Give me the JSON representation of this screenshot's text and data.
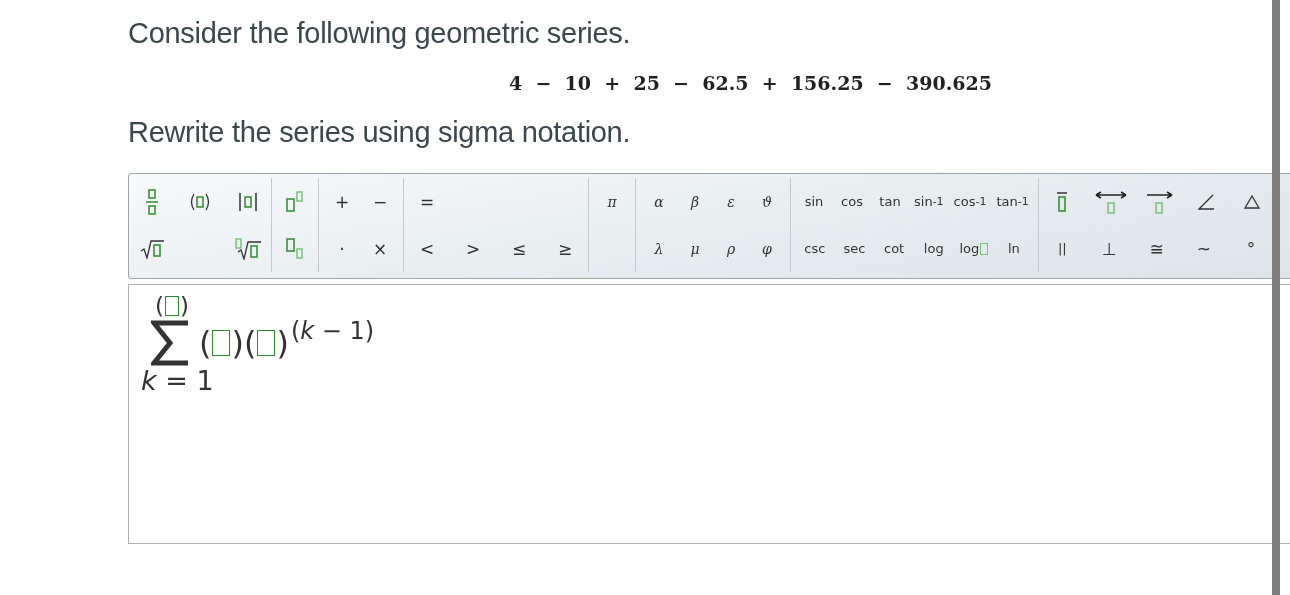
{
  "question": {
    "intro": "Consider the following geometric series.",
    "series": "4  −  10  +  25  −  62.5  +  156.25  −  390.625",
    "prompt": "Rewrite the series using sigma notation."
  },
  "toolbar": {
    "groups": [
      {
        "top": [
          {
            "kind": "fraction"
          },
          {
            "kind": "parens"
          },
          {
            "kind": "abs"
          }
        ],
        "bottom": [
          {
            "kind": "sqrt"
          },
          {
            "kind": "nthroot"
          }
        ]
      },
      {
        "top": [
          {
            "kind": "superscript"
          }
        ],
        "bottom": [
          {
            "kind": "subscript"
          }
        ]
      },
      {
        "top": [
          {
            "kind": "text",
            "label": "+"
          },
          {
            "kind": "text",
            "label": "−"
          }
        ],
        "bottom": [
          {
            "kind": "text",
            "label": "·"
          },
          {
            "kind": "text",
            "label": "×"
          }
        ]
      },
      {
        "top": [
          {
            "kind": "text",
            "label": "="
          }
        ],
        "bottom": [
          {
            "kind": "text",
            "label": "<"
          },
          {
            "kind": "text",
            "label": ">"
          },
          {
            "kind": "text",
            "label": "≤"
          },
          {
            "kind": "text",
            "label": "≥"
          }
        ]
      },
      {
        "top": [
          {
            "kind": "greek",
            "label": "π"
          }
        ]
      },
      {
        "top": [
          {
            "kind": "greek",
            "label": "α"
          },
          {
            "kind": "greek",
            "label": "β"
          },
          {
            "kind": "greek",
            "label": "ε"
          },
          {
            "kind": "greek",
            "label": "ϑ"
          }
        ],
        "bottom": [
          {
            "kind": "greek",
            "label": "λ"
          },
          {
            "kind": "greek",
            "label": "μ"
          },
          {
            "kind": "greek",
            "label": "ρ"
          },
          {
            "kind": "greek",
            "label": "φ"
          }
        ]
      },
      {
        "top": [
          {
            "kind": "text",
            "label": "sin"
          },
          {
            "kind": "text",
            "label": "cos"
          },
          {
            "kind": "text",
            "label": "tan"
          },
          {
            "kind": "inverse",
            "label": "sin",
            "sup": "-1"
          },
          {
            "kind": "inverse",
            "label": "cos",
            "sup": "-1"
          },
          {
            "kind": "inverse",
            "label": "tan",
            "sup": "-1"
          }
        ],
        "bottom": [
          {
            "kind": "text",
            "label": "csc"
          },
          {
            "kind": "text",
            "label": "sec"
          },
          {
            "kind": "text",
            "label": "cot"
          },
          {
            "kind": "text",
            "label": "log"
          },
          {
            "kind": "log-base",
            "label": "log"
          },
          {
            "kind": "text",
            "label": "ln"
          }
        ]
      },
      {
        "top": [
          {
            "kind": "overline"
          },
          {
            "kind": "line"
          },
          {
            "kind": "ray"
          },
          {
            "kind": "angle"
          },
          {
            "kind": "triangle"
          }
        ],
        "bottom": [
          {
            "kind": "text",
            "label": "||"
          },
          {
            "kind": "text",
            "label": "⊥"
          },
          {
            "kind": "text",
            "label": "≅"
          },
          {
            "kind": "text",
            "label": "~"
          },
          {
            "kind": "text",
            "label": "°"
          }
        ]
      }
    ]
  },
  "answer": {
    "upper_limit": [
      "(",
      ")"
    ],
    "factors": [
      [
        "(",
        ")"
      ],
      [
        "(",
        ")"
      ]
    ],
    "exponent": "(*k* − 1)",
    "lower_limit": "*k* = 1"
  }
}
